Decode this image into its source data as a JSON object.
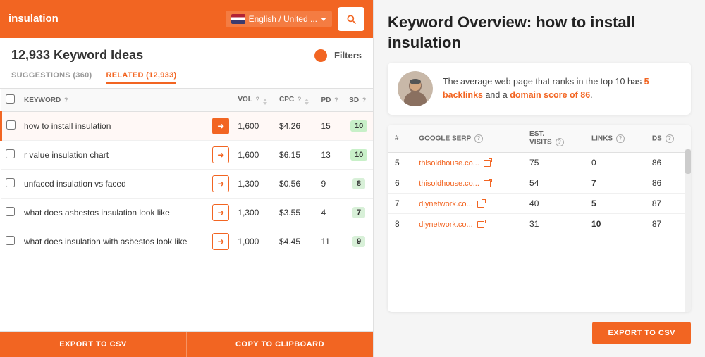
{
  "search": {
    "query": "insulation",
    "language": "English / United ...",
    "placeholder": "insulation"
  },
  "left": {
    "keyword_count": "12,933 Keyword Ideas",
    "filter_label": "Filters",
    "tabs": [
      {
        "label": "SUGGESTIONS (360)",
        "active": false
      },
      {
        "label": "RELATED (12,933)",
        "active": true
      }
    ],
    "table": {
      "headers": [
        "",
        "KEYWORD",
        "",
        "VOL",
        "",
        "CPC",
        "",
        "PD",
        "SD"
      ],
      "rows": [
        {
          "keyword": "how to install insulation",
          "vol": "1,600",
          "cpc": "$4.26",
          "pd": "15",
          "sd": "10",
          "sd_color": "green",
          "highlighted": true
        },
        {
          "keyword": "r value insulation chart",
          "vol": "1,600",
          "cpc": "$6.15",
          "pd": "13",
          "sd": "10",
          "sd_color": "green"
        },
        {
          "keyword": "unfaced insulation vs faced",
          "vol": "1,300",
          "cpc": "$0.56",
          "pd": "9",
          "sd": "8",
          "sd_color": "lightgreen"
        },
        {
          "keyword": "what does asbestos insulation look like",
          "vol": "1,300",
          "cpc": "$3.55",
          "pd": "4",
          "sd": "7",
          "sd_color": "lightgreen"
        },
        {
          "keyword": "what does insulation with asbestos look like",
          "vol": "1,000",
          "cpc": "$4.45",
          "pd": "11",
          "sd": "9",
          "sd_color": "lightgreen"
        }
      ]
    },
    "export_btn": "EXPORT TO CSV",
    "clipboard_btn": "COPY TO CLIPBOARD"
  },
  "right": {
    "title_bold": "Keyword Overview:",
    "title_rest": " how to install insulation",
    "info_text_1": "The average web page that ranks in the top 10 has ",
    "info_highlight_1": "5 backlinks",
    "info_text_2": " and a ",
    "info_highlight_2": "domain score of 86",
    "info_text_3": ".",
    "serp_table": {
      "headers": [
        "#",
        "GOOGLE SERP",
        "EST. VISITS",
        "LINKS",
        "DS"
      ],
      "rows": [
        {
          "num": "5",
          "site": "thisoldhouse.co...",
          "visits": "75",
          "links": "0",
          "ds": "86",
          "links_orange": false
        },
        {
          "num": "6",
          "site": "thisoldhouse.co...",
          "visits": "54",
          "links": "7",
          "ds": "86",
          "links_orange": true
        },
        {
          "num": "7",
          "site": "diynetwork.co...",
          "visits": "40",
          "links": "5",
          "ds": "87",
          "links_orange": true
        },
        {
          "num": "8",
          "site": "diynetwork.co...",
          "visits": "31",
          "links": "10",
          "ds": "87",
          "links_orange": true
        }
      ]
    },
    "export_btn": "EXPORT TO CSV"
  }
}
